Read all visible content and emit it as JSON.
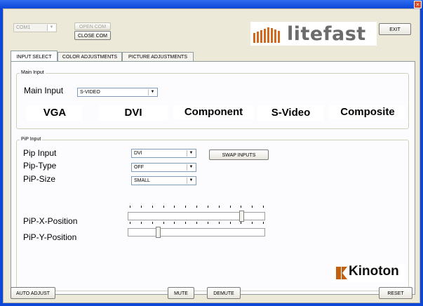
{
  "window": {
    "close_glyph": "×"
  },
  "top": {
    "com_port": {
      "value": "COM1",
      "disabled": true
    },
    "open_com_label": "OPEN COM",
    "close_com_label": "CLOSE COM",
    "exit_label": "EXIT",
    "logo_text": "litefast"
  },
  "tabs": [
    {
      "label": "INPUT SELECT",
      "active": true
    },
    {
      "label": "COLOR ADJUSTMENTS",
      "active": false
    },
    {
      "label": "PICTURE ADJUSTMENTS",
      "active": false
    }
  ],
  "main_input": {
    "group_label": "Main Input",
    "label": "Main Input",
    "value": "S-VIDEO",
    "buttons": [
      "VGA",
      "DVI",
      "Component",
      "S-Video",
      "Composite"
    ]
  },
  "pip": {
    "group_label": "PiP Input",
    "input_label": "Pip Input",
    "input_value": "DVI",
    "type_label": "Pip-Type",
    "type_value": "OFF",
    "size_label": "PiP-Size",
    "size_value": "SMALL",
    "swap_label": "SWAP INPUTS",
    "x_label": "PiP-X-Position",
    "y_label": "PiP-Y-Position",
    "x_position": 0.84,
    "y_position": 0.21,
    "logo_text": "Kinoton"
  },
  "bottom": {
    "auto_adjust_label": "AUTO ADJUST",
    "mute_label": "MUTE",
    "demute_label": "DEMUTE",
    "reset_label": "RESET"
  },
  "colors": {
    "titlebar": "#0c47d8",
    "litefast_logo": "#6b6b6b",
    "litefast_bars": "#d2691e",
    "kinoton_logo": "#c06010"
  }
}
